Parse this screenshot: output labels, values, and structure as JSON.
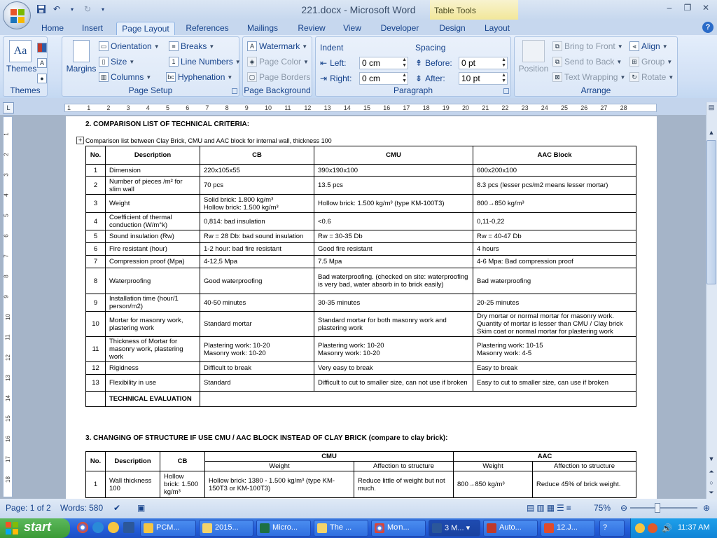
{
  "window": {
    "title": "221.docx - Microsoft Word",
    "table_tools_label": "Table Tools",
    "controls": [
      "–",
      "❐",
      "✕"
    ]
  },
  "tabs": [
    {
      "label": "Home"
    },
    {
      "label": "Insert"
    },
    {
      "label": "Page Layout",
      "active": true
    },
    {
      "label": "References"
    },
    {
      "label": "Mailings"
    },
    {
      "label": "Review"
    },
    {
      "label": "View"
    },
    {
      "label": "Developer"
    },
    {
      "label": "Design"
    },
    {
      "label": "Layout"
    }
  ],
  "ribbon": {
    "themes": {
      "group": "Themes",
      "themes_btn": "Themes"
    },
    "page_setup": {
      "group": "Page Setup",
      "margins": "Margins",
      "orientation": "Orientation",
      "size": "Size",
      "columns": "Columns",
      "breaks": "Breaks",
      "line_numbers": "Line Numbers",
      "hyphenation": "Hyphenation"
    },
    "page_background": {
      "group": "Page Background",
      "watermark": "Watermark",
      "page_color": "Page Color",
      "page_borders": "Page Borders"
    },
    "paragraph": {
      "group": "Paragraph",
      "indent": "Indent",
      "left_label": "Left:",
      "left_value": "0 cm",
      "right_label": "Right:",
      "right_value": "0 cm",
      "spacing": "Spacing",
      "before_label": "Before:",
      "before_value": "0 pt",
      "after_label": "After:",
      "after_value": "10 pt"
    },
    "arrange": {
      "group": "Arrange",
      "position": "Position",
      "bring_to_front": "Bring to Front",
      "send_to_back": "Send to Back",
      "text_wrapping": "Text Wrapping",
      "align": "Align",
      "group_btn": "Group",
      "rotate": "Rotate"
    }
  },
  "ruler": {
    "h_marks": [
      "1",
      "1",
      "2",
      "3",
      "4",
      "5",
      "6",
      "7",
      "8",
      "9",
      "10",
      "11",
      "12",
      "13",
      "14",
      "15",
      "16",
      "17",
      "18",
      "19",
      "20",
      "21",
      "22",
      "23",
      "24",
      "25",
      "26",
      "27",
      "28"
    ],
    "v_marks": [
      "1",
      "2",
      "3",
      "4",
      "5",
      "6",
      "7",
      "8",
      "9",
      "10",
      "11",
      "12",
      "13",
      "14",
      "15",
      "16",
      "17",
      "18"
    ]
  },
  "document": {
    "heading2": "2. COMPARISON LIST OF TECHNICAL CRITERIA:",
    "caption": "Comparison list between Clay Brick, CMU and AAC block for internal wall, thickness 100",
    "table1": {
      "headers": [
        "No.",
        "Description",
        "CB",
        "CMU",
        "AAC Block"
      ],
      "rows": [
        [
          "1",
          "Dimension",
          "220x105x55",
          "390x190x100",
          "600x200x100"
        ],
        [
          "2",
          "Number of pieces /m² for slim wall",
          "70 pcs",
          "13.5 pcs",
          "8.3 pcs (lesser pcs/m2 means lesser mortar)"
        ],
        [
          "3",
          "Weight",
          "Solid brick: 1.800 kg/m³\nHollow brick: 1.500 kg/m³",
          "Hollow brick: 1.500 kg/m³ (type KM-100T3)",
          "800→850 kg/m³"
        ],
        [
          "4",
          "Coefficient of thermal conduction (W/m°k)",
          "0,814: bad insulation",
          "<0.6",
          "0,11-0,22"
        ],
        [
          "5",
          "Sound insulation (Rw)",
          "Rw = 28 Db: bad sound insulation",
          "Rw = 30-35 Db",
          "Rw = 40-47 Db"
        ],
        [
          "6",
          "Fire resistant (hour)",
          "1-2 hour: bad fire resistant",
          "Good fire resistant",
          "4 hours"
        ],
        [
          "7",
          "Compression proof (Mpa)",
          "4-12,5 Mpa",
          "7.5 Mpa",
          "4-6 Mpa: Bad compression proof"
        ],
        [
          "8",
          "Waterproofing",
          "Good waterproofing",
          "Bad waterproofing. (checked on site: waterproofing is very bad, water absorb in to brick easily)",
          "Bad waterproofing"
        ],
        [
          "9",
          "Installation time (hour/1 person/m2)",
          "40-50 minutes",
          "30-35 minutes",
          "20-25 minutes"
        ],
        [
          "10",
          "Mortar for masonry work, plastering work",
          "Standard mortar",
          "Standard mortar for both masonry work and plastering work",
          "Dry mortar or normal mortar for masonry work. Quantity of mortar is lesser than CMU / Clay brick Skim coat or normal mortar for plastering work"
        ],
        [
          "11",
          "Thickness of Mortar for masonry work, plastering work",
          "Plastering work: 10-20\nMasonry work: 10-20",
          "Plastering work: 10-20\nMasonry work: 10-20",
          "Plastering work: 10-15\nMasonry work: 4-5"
        ],
        [
          "12",
          "Rigidness",
          "Difficult to break",
          "Very easy to break",
          "Easy to break"
        ],
        [
          "13",
          "Flexibility in use",
          "Standard",
          "Difficult to cut to smaller size, can not use if broken",
          "Easy to cut to smaller size, can use if broken"
        ]
      ],
      "evaluation": "TECHNICAL EVALUATION"
    },
    "heading3": "3. CHANGING OF STRUCTURE IF USE CMU / AAC BLOCK INSTEAD OF CLAY BRICK (compare to clay brick):",
    "table2": {
      "headers": [
        "No.",
        "Description",
        "CB",
        "CMU",
        "AAC"
      ],
      "subheaders": [
        "Weight",
        "Affection to structure",
        "Weight",
        "Affection to structure"
      ],
      "rows": [
        [
          "1",
          "Wall thickness 100",
          "Hollow brick: 1.500 kg/m³",
          "Hollow brick: 1380 - 1.500 kg/m³ (type KM-150T3 or KM-100T3)",
          "Reduce little of weight but not much.",
          "800→850 kg/m³",
          "Reduce 45% of brick weight."
        ]
      ]
    }
  },
  "status": {
    "page": "Page: 1 of 2",
    "words": "Words: 580",
    "zoom": "75%"
  },
  "taskbar": {
    "start": "start",
    "items": [
      "PCM...",
      "2015...",
      "Micro...",
      "The ...",
      "Mơn...",
      "3 M...",
      "Auto...",
      "12.J..."
    ],
    "clock": "11:37 AM"
  }
}
